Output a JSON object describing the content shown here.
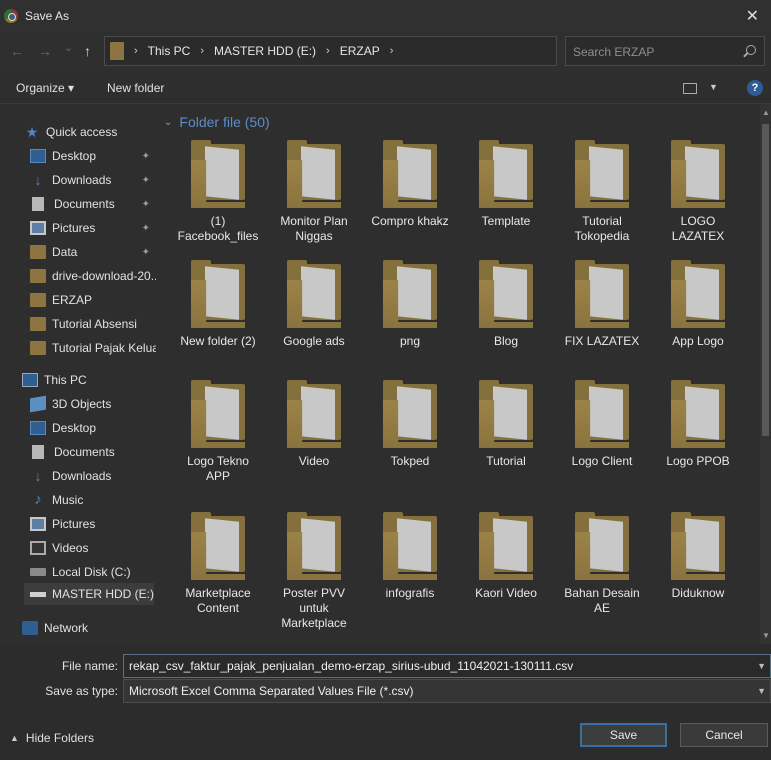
{
  "window": {
    "title": "Save As"
  },
  "navigation": {
    "back": "←",
    "forward": "→",
    "recent": "⌄",
    "up": "↑",
    "breadcrumb": [
      "This PC",
      "MASTER HDD (E:)",
      "ERZAP"
    ],
    "search_placeholder": "Search ERZAP"
  },
  "toolbar": {
    "organize_label": "Organize ▾",
    "new_folder_label": "New folder",
    "help": "?"
  },
  "sidebar": {
    "items": [
      {
        "label": "Quick access"
      },
      {
        "label": "Desktop"
      },
      {
        "label": "Downloads"
      },
      {
        "label": "Documents"
      },
      {
        "label": "Pictures"
      },
      {
        "label": "Data"
      },
      {
        "label": "drive-download-20..."
      },
      {
        "label": "ERZAP"
      },
      {
        "label": "Tutorial Absensi"
      },
      {
        "label": "Tutorial Pajak Keluaran"
      },
      {
        "label": "This PC"
      },
      {
        "label": "3D Objects"
      },
      {
        "label": "Desktop"
      },
      {
        "label": "Documents"
      },
      {
        "label": "Downloads"
      },
      {
        "label": "Music"
      },
      {
        "label": "Pictures"
      },
      {
        "label": "Videos"
      },
      {
        "label": "Local Disk (C:)"
      },
      {
        "label": "MASTER HDD (E:)"
      },
      {
        "label": "Network"
      }
    ]
  },
  "content": {
    "group_label": "Folder file (50)",
    "folders": [
      {
        "name": "(1)\nFacebook_files"
      },
      {
        "name": "Monitor Plan\nNiggas"
      },
      {
        "name": "Compro khakz"
      },
      {
        "name": "Template"
      },
      {
        "name": "Tutorial\nTokopedia"
      },
      {
        "name": "LOGO\nLAZATEX"
      },
      {
        "name": "New folder (2)"
      },
      {
        "name": "Google ads"
      },
      {
        "name": "png"
      },
      {
        "name": "Blog"
      },
      {
        "name": "FIX LAZATEX"
      },
      {
        "name": "App Logo"
      },
      {
        "name": "Logo Tekno\nAPP"
      },
      {
        "name": "Video"
      },
      {
        "name": "Tokped"
      },
      {
        "name": "Tutorial"
      },
      {
        "name": "Logo Client"
      },
      {
        "name": "Logo PPOB"
      },
      {
        "name": "Marketplace\nContent"
      },
      {
        "name": "Poster PVV\nuntuk\nMarketplace"
      },
      {
        "name": "infografis"
      },
      {
        "name": "Kaori Video"
      },
      {
        "name": "Bahan Desain\nAE"
      },
      {
        "name": "Diduknow"
      }
    ]
  },
  "form": {
    "file_name_label": "File name:",
    "file_name_value": "rekap_csv_faktur_pajak_penjualan_demo-erzap_sirius-ubud_11042021-130111.csv",
    "save_type_label": "Save as type:",
    "save_type_value": "Microsoft Excel Comma Separated Values File (*.csv)"
  },
  "footer": {
    "hide_folders_label": "Hide Folders",
    "save_label": "Save",
    "cancel_label": "Cancel"
  },
  "colors": {
    "accent": "#3a6ea8",
    "group_header": "#5b8ec9",
    "folder": "#84703c"
  }
}
